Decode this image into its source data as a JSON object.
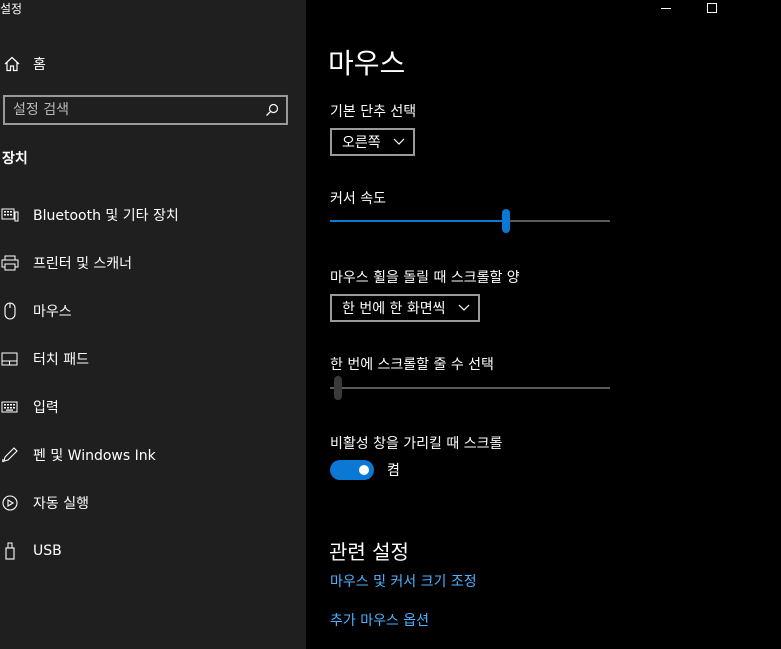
{
  "app": {
    "title": "설정"
  },
  "window_controls": {
    "minimize": "—",
    "maximize": "☐"
  },
  "sidebar": {
    "home_label": "홈",
    "search_placeholder": "설정 검색",
    "section_title": "장치",
    "items": [
      {
        "label": "Bluetooth 및 기타 장치",
        "icon": "keyboard-device-icon"
      },
      {
        "label": "프린터 및 스캐너",
        "icon": "printer-icon"
      },
      {
        "label": "마우스",
        "icon": "mouse-icon"
      },
      {
        "label": "터치 패드",
        "icon": "touchpad-icon"
      },
      {
        "label": "입력",
        "icon": "keyboard-icon"
      },
      {
        "label": "펜 및 Windows Ink",
        "icon": "pen-icon"
      },
      {
        "label": "자동 실행",
        "icon": "autoplay-icon"
      },
      {
        "label": "USB",
        "icon": "usb-icon"
      }
    ]
  },
  "main": {
    "title": "마우스",
    "primary_button": {
      "label": "기본 단추 선택",
      "value": "오른쪽"
    },
    "cursor_speed": {
      "label": "커서 속도",
      "value_fraction": 0.63
    },
    "wheel_scroll": {
      "label": "마우스 휠을 돌릴 때 스크롤할 양",
      "value": "한 번에 한 화면씩"
    },
    "lines_to_scroll": {
      "label": "한 번에 스크롤할 줄 수 선택",
      "value_fraction": 0.03
    },
    "inactive_scroll": {
      "label": "비활성 창을 가리킬 때 스크롤",
      "state": "켬",
      "on": true
    },
    "related": {
      "title": "관련 설정",
      "links": [
        "마우스 및 커서 크기 조정",
        "추가 마우스 옵션"
      ]
    }
  },
  "colors": {
    "accent": "#0a78d4",
    "link": "#4cb3ff",
    "sidebar_bg": "#1f1f1f",
    "main_bg": "#000000",
    "slider_track": "#5a5a5a",
    "slider_thumb_inactive": "#3a3a3a"
  }
}
